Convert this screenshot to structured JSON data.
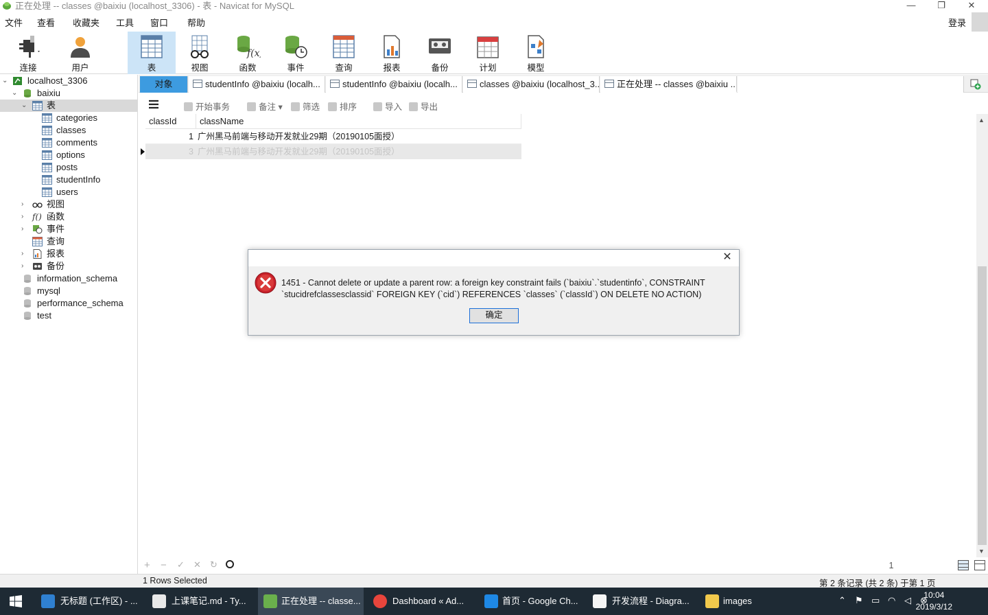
{
  "window": {
    "title": "正在处理 -- classes @baixiu (localhost_3306) - 表 - Navicat for MySQL"
  },
  "menu": {
    "items": [
      "文件",
      "查看",
      "收藏夹",
      "工具",
      "窗口",
      "帮助"
    ],
    "login": "登录"
  },
  "toolbar": {
    "items": [
      {
        "label": "连接",
        "icon": "plug-icon"
      },
      {
        "label": "用户",
        "icon": "user-icon"
      },
      {
        "label": "表",
        "icon": "table-icon"
      },
      {
        "label": "视图",
        "icon": "glasses-icon"
      },
      {
        "label": "函数",
        "icon": "function-icon"
      },
      {
        "label": "事件",
        "icon": "event-icon"
      },
      {
        "label": "查询",
        "icon": "query-icon"
      },
      {
        "label": "报表",
        "icon": "report-icon"
      },
      {
        "label": "备份",
        "icon": "backup-icon"
      },
      {
        "label": "计划",
        "icon": "calendar-icon"
      },
      {
        "label": "模型",
        "icon": "model-icon"
      }
    ],
    "selected": "表"
  },
  "sidebar": {
    "connection": "localhost_3306",
    "database": "baixiu",
    "tables_node": "表",
    "tables": [
      "categories",
      "classes",
      "comments",
      "options",
      "posts",
      "studentInfo",
      "users"
    ],
    "nodes": [
      "视图",
      "函数",
      "事件",
      "查询",
      "报表",
      "备份"
    ],
    "other_dbs": [
      "information_schema",
      "mysql",
      "performance_schema",
      "test"
    ]
  },
  "tabs": {
    "items": [
      "对象",
      "studentInfo @baixiu (localh...",
      "studentInfo @baixiu (localh...",
      "classes @baixiu (localhost_3...",
      "正在处理 -- classes @baixiu ..."
    ]
  },
  "subtoolbar": {
    "items": [
      "开始事务",
      "备注",
      "筛选",
      "排序",
      "导入",
      "导出"
    ]
  },
  "grid": {
    "columns": [
      "classId",
      "className"
    ],
    "rows": [
      [
        "1",
        "广州黑马前端与移动开发就业29期（20190105面授）"
      ],
      [
        "3",
        "广州黑马前端与移动开发就业29期（20190105面授）"
      ]
    ]
  },
  "dialog": {
    "message": "1451 - Cannot delete or update a parent row: a foreign key constraint fails (`baixiu`.`studentinfo`, CONSTRAINT `stucidrefclassesclassid` FOREIGN KEY (`cid`) REFERENCES `classes` (`classId`) ON DELETE NO ACTION)",
    "ok_label": "确定"
  },
  "bottombar": {
    "page": "1"
  },
  "status": {
    "left": "1 Rows Selected",
    "right": "第 2 条记录 (共 2 条) 于第 1 页"
  },
  "taskbar": {
    "items": [
      {
        "label": "无标题 (工作区) - ...",
        "color": "#2f80d1"
      },
      {
        "label": "上课笔记.md - Ty...",
        "color": "#e8e8e8"
      },
      {
        "label": "正在处理 -- classe...",
        "color": "#6ab04c"
      },
      {
        "label": "Dashboard « Ad...",
        "color": "#e8453c"
      },
      {
        "label": "首页 - Google Ch...",
        "color": "#1e88e5"
      },
      {
        "label": "开发流程 - Diagra...",
        "color": "#f5f5f5"
      },
      {
        "label": "images",
        "color": "#f2c94c"
      }
    ],
    "time": "10:04",
    "date": "2019/3/12"
  }
}
